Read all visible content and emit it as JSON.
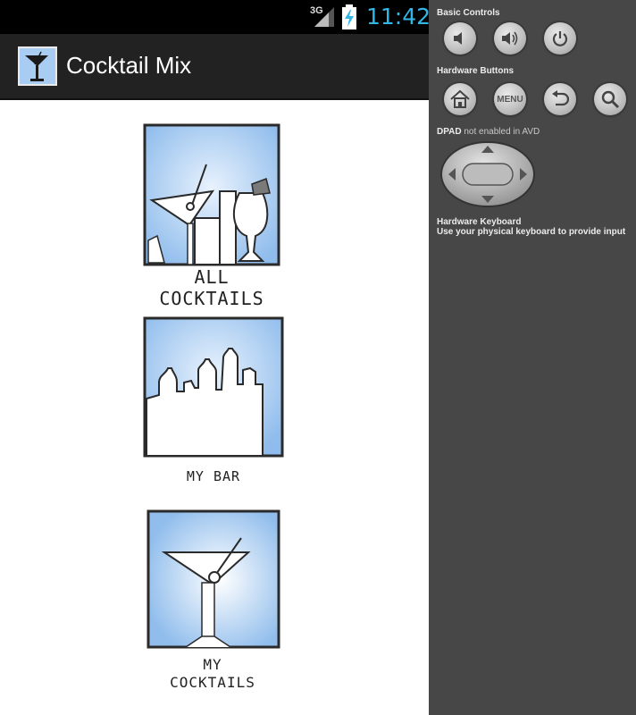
{
  "status_bar": {
    "network_type": "3G",
    "time": "11:42"
  },
  "action_bar": {
    "title": "Cocktail Mix"
  },
  "tiles": {
    "all_cocktails": {
      "line1": "ALL",
      "line2": "COCKTAILS"
    },
    "my_bar": {
      "caption": "MY BAR"
    },
    "my_cocktails": {
      "line1": "MY",
      "line2": "COCKTAILS"
    }
  },
  "controls": {
    "basic_controls_label": "Basic Controls",
    "hardware_buttons_label": "Hardware Buttons",
    "menu_button_label": "MENU",
    "dpad_label": "DPAD",
    "dpad_status": "not enabled in AVD",
    "keyboard_title": "Hardware Keyboard",
    "keyboard_desc": "Use your physical keyboard to provide input"
  },
  "icons": {
    "volume_down": "volume-down-icon",
    "volume_up": "volume-up-icon",
    "power": "power-icon",
    "home": "home-icon",
    "back": "back-icon",
    "search": "search-icon"
  },
  "colors": {
    "clock": "#33b5e5",
    "tile_sky": "#9fc6f2",
    "action_bar": "#222222",
    "control_panel": "#474747"
  }
}
